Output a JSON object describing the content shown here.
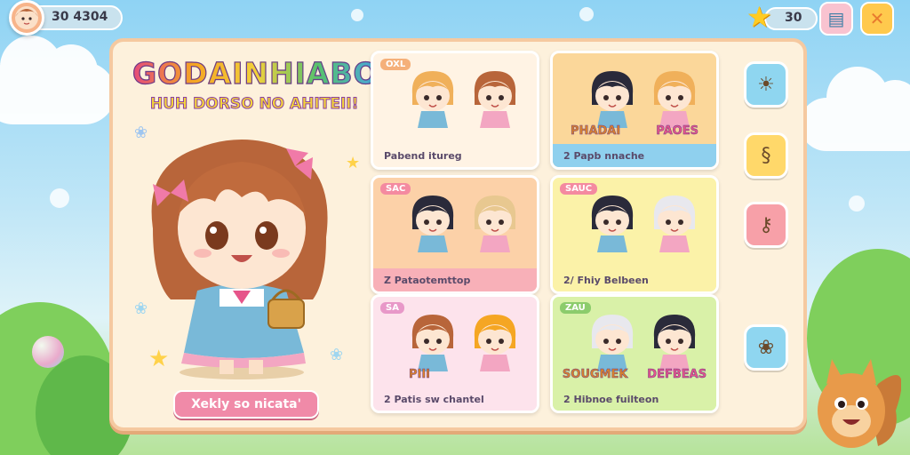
{
  "hud": {
    "currency": "30 4304",
    "stars": "30"
  },
  "panel": {
    "title": "GODAINHIABO",
    "subtitle": "HUH DORSO NO AHITEII!"
  },
  "cta_label": "Xekly so nicata'",
  "cards": [
    {
      "tag": "OXL",
      "footer": "Pabend itureg",
      "names": [
        "",
        ""
      ],
      "tag_color": "#f5b07a",
      "bg": "#fff3e4",
      "footer_bg": "#fff3e4"
    },
    {
      "tag": "",
      "footer": "2 Papb nnache",
      "names": [
        "PHADAI",
        "PAOES"
      ],
      "tag_color": "#f5b07a",
      "bg": "#fbd79a",
      "footer_bg": "#8fd0ee"
    },
    {
      "tag": "SAC",
      "footer": "Z Pataotemttop",
      "names": [
        "",
        ""
      ],
      "tag_color": "#f48aa0",
      "bg": "#fcd1a8",
      "footer_bg": "#f8b0b8"
    },
    {
      "tag": "SAUC",
      "footer": "2/ Fhiy Belbeen",
      "names": [
        "",
        ""
      ],
      "tag_color": "#f48aa0",
      "bg": "#fbf2a8",
      "footer_bg": "#fbf2a8"
    },
    {
      "tag": "SA",
      "footer": "2 Patis sw chantel",
      "names": [
        "PIII",
        ""
      ],
      "tag_color": "#e898c8",
      "bg": "#fde3ec",
      "footer_bg": "#fde3ec"
    },
    {
      "tag": "ZAU",
      "footer": "2 Hibnoe fuilteon",
      "names": [
        "SOUGMEK",
        "DEFBEAS"
      ],
      "tag_color": "#8ccc6c",
      "bg": "#d9f1a8",
      "footer_bg": "#d9f1a8"
    }
  ],
  "side_buttons": [
    {
      "icon": "sun-icon",
      "glyph": "☀",
      "color": "#8fd6f0"
    },
    {
      "icon": "swirl-icon",
      "glyph": "§",
      "color": "#ffd86a"
    },
    {
      "icon": "key-icon",
      "glyph": "⚷",
      "color": "#f7a0a8"
    },
    {
      "icon": "flower-icon",
      "glyph": "❀",
      "color": "#8fd6f0"
    }
  ]
}
